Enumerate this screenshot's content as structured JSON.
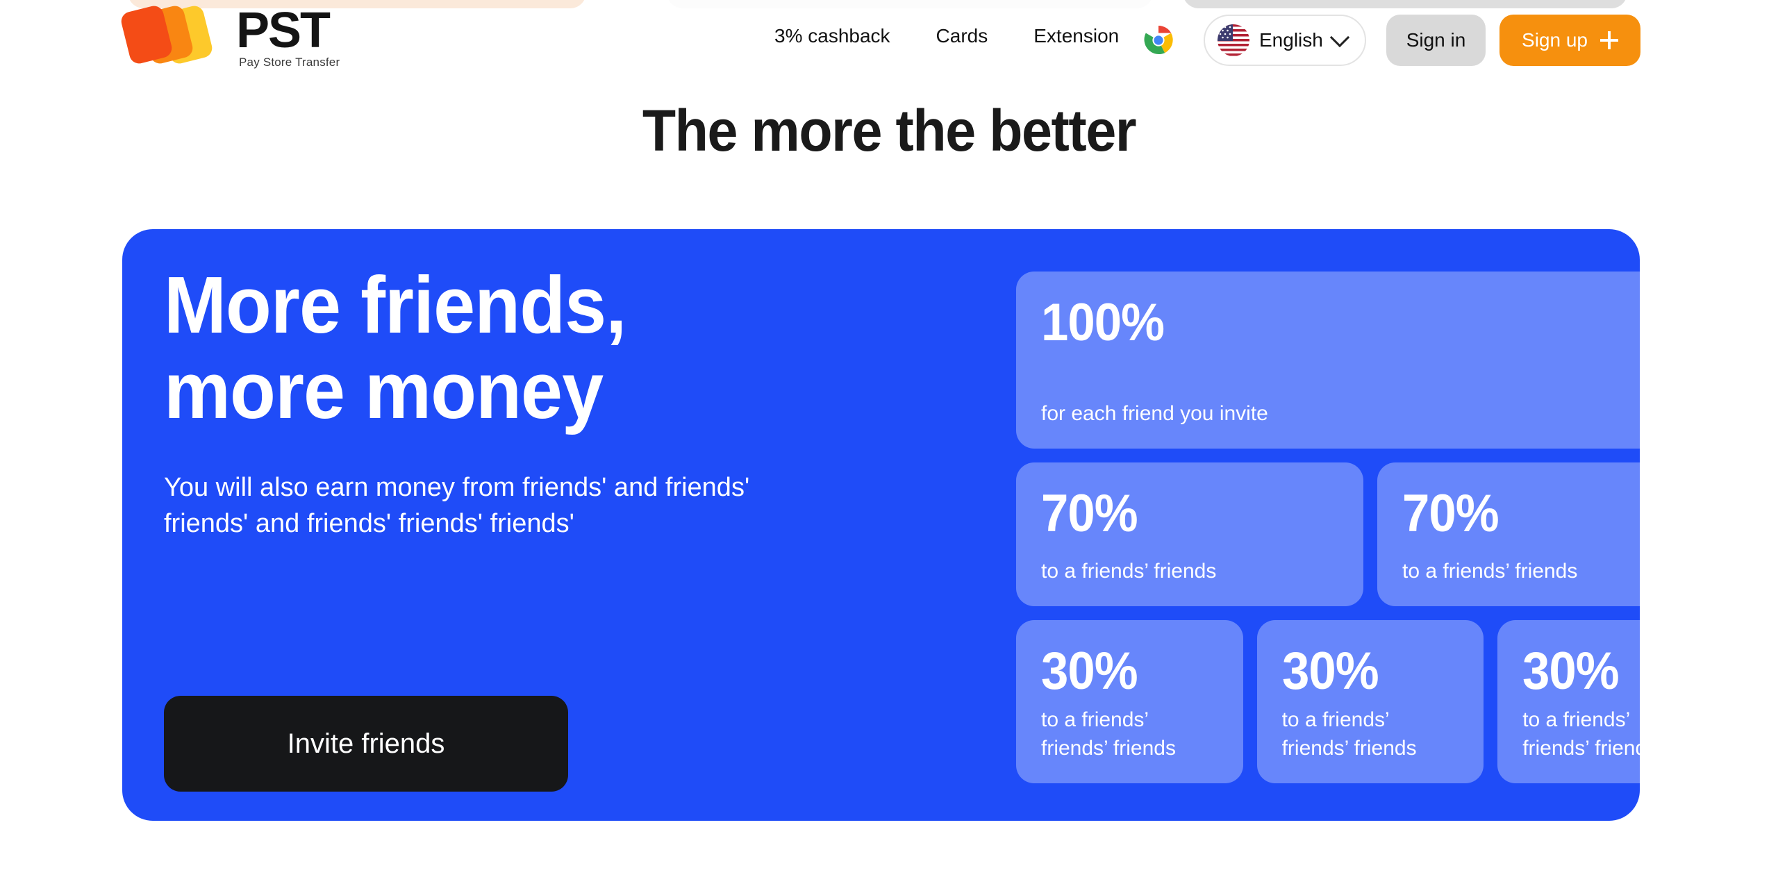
{
  "top_remnants": [
    {
      "name": "peach-pill-remnant",
      "color": "#fbe9da"
    },
    {
      "name": "faint-pill-remnant",
      "color": "#fcfcfc"
    },
    {
      "name": "gray-pill-remnant",
      "color": "#dedede"
    }
  ],
  "header": {
    "logo": {
      "title": "PST",
      "subtitle": "Pay Store Transfer",
      "card_colors": [
        "#f44c16",
        "#f98612",
        "#fdc92b"
      ]
    },
    "nav": [
      {
        "label": "3% cashback"
      },
      {
        "label": "Cards"
      },
      {
        "label": "Extension"
      }
    ],
    "extension_icon": "chrome-icon",
    "language": {
      "label": "English",
      "flag": "us-flag-icon",
      "chevron": "chevron-down-icon"
    },
    "sign_in_label": "Sign in",
    "sign_up_label": "Sign up",
    "sign_up_icon": "plus-icon"
  },
  "page_title": "The more the better",
  "hero": {
    "title": "More friends,\nmore money",
    "subtitle": "You will also earn money from friends' and friends' friends' and friends' friends' friends'",
    "cta_label": "Invite friends",
    "panel_color": "#1f4cf8",
    "card_color": "#6786fb",
    "cta_color": "#161719"
  },
  "stats": {
    "row1": [
      {
        "value": "100%",
        "label": "for each friend you invite"
      }
    ],
    "row2": [
      {
        "value": "70%",
        "label": "to a friends’ friends"
      },
      {
        "value": "70%",
        "label": "to a friends’ friends"
      }
    ],
    "row3": [
      {
        "value": "30%",
        "label": "to a friends’\nfriends’ friends"
      },
      {
        "value": "30%",
        "label": "to a friends’\nfriends’ friends"
      },
      {
        "value": "30%",
        "label": "to a friends’\nfriends’ friends"
      }
    ]
  }
}
